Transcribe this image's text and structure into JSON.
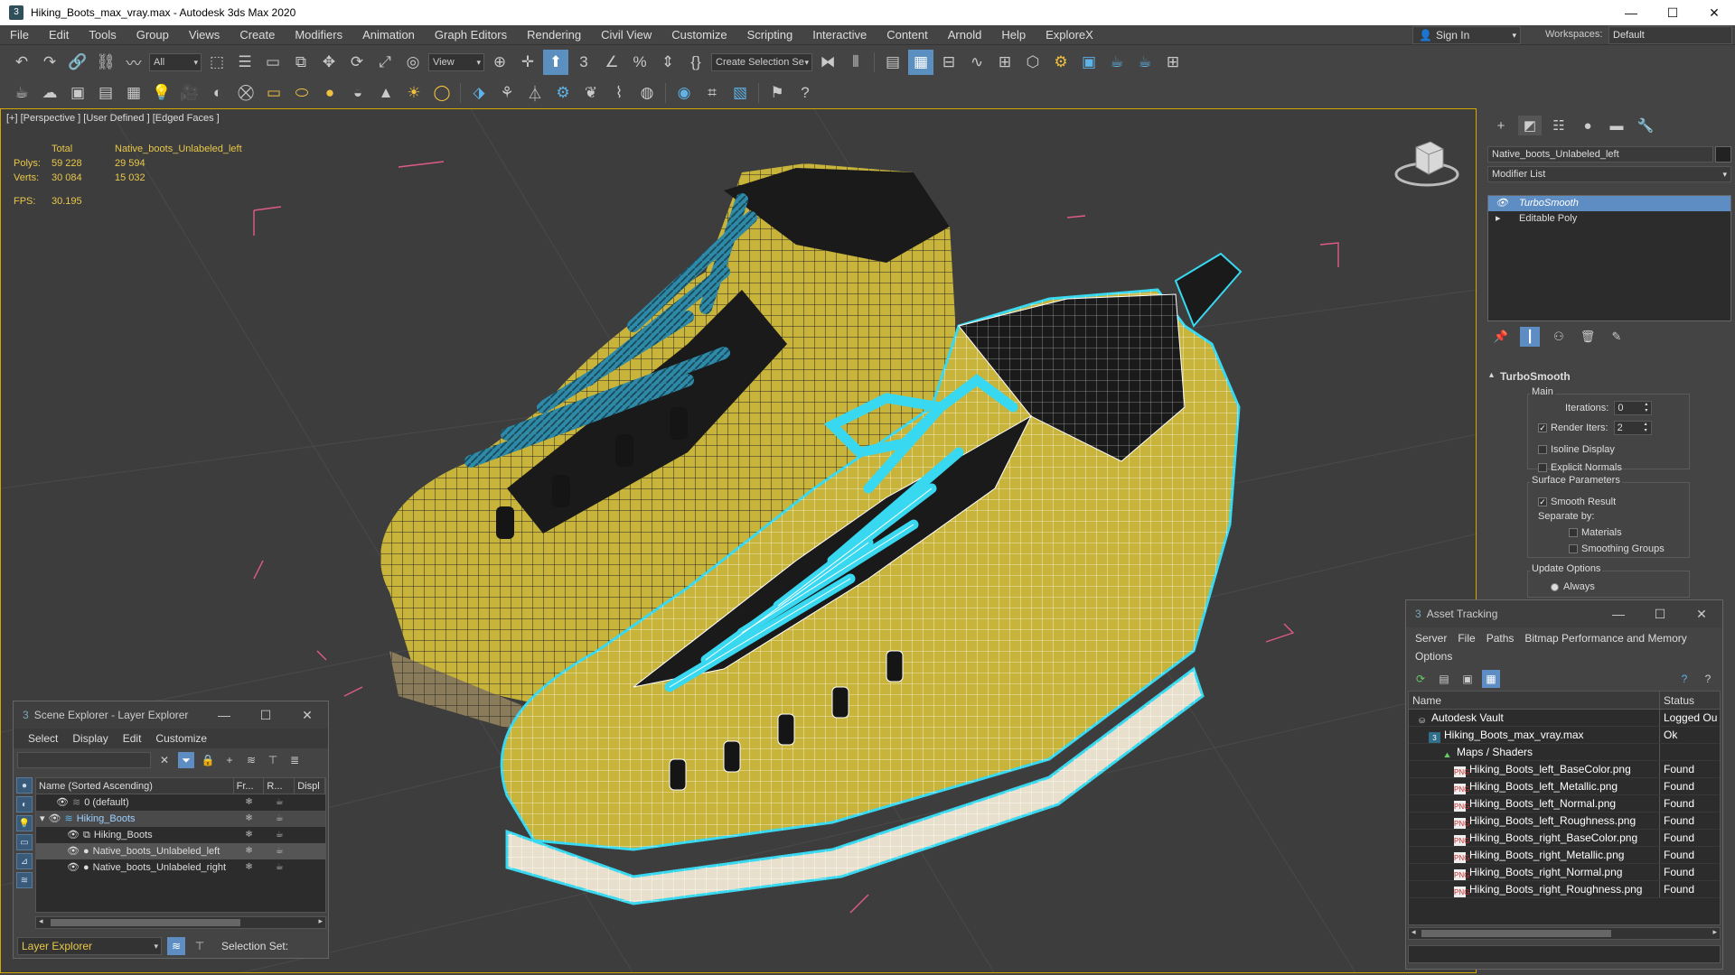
{
  "window": {
    "title": "Hiking_Boots_max_vray.max - Autodesk 3ds Max 2020",
    "controls": [
      "—",
      "☐",
      "✕"
    ]
  },
  "menubar": {
    "items": [
      "File",
      "Edit",
      "Tools",
      "Group",
      "Views",
      "Create",
      "Modifiers",
      "Animation",
      "Graph Editors",
      "Rendering",
      "Civil View",
      "Customize",
      "Scripting",
      "Interactive",
      "Content",
      "Arnold",
      "Help",
      "ExploreX"
    ],
    "sign_in": "Sign In",
    "workspaces_label": "Workspaces:",
    "workspace_value": "Default"
  },
  "toolbar": {
    "selection_filter": "All",
    "ref_coord": "View",
    "named_selection": "Create Selection Se"
  },
  "viewport": {
    "label": "[+] [Perspective ] [User Defined ] [Edged Faces ]",
    "stats": {
      "total_label": "Total",
      "object_label": "Native_boots_Unlabeled_left",
      "polys_label": "Polys:",
      "polys_total": "59 228",
      "polys_object": "29 594",
      "verts_label": "Verts:",
      "verts_total": "30 084",
      "verts_object": "15 032",
      "fps_label": "FPS:",
      "fps_value": "30.195"
    },
    "colors": {
      "frame": "#d4a800",
      "boot": "#c8b43a",
      "laces": "#2e8aa8",
      "selection": "#38d8f0",
      "bbox": "#e05a88"
    }
  },
  "command_panel": {
    "object_name": "Native_boots_Unlabeled_left",
    "modifier_list": "Modifier List",
    "stack": [
      "TurboSmooth",
      "Editable Poly"
    ],
    "rollout_title": "TurboSmooth",
    "main_group": "Main",
    "iterations_label": "Iterations:",
    "iterations_value": "0",
    "render_iters_label": "Render Iters:",
    "render_iters_value": "2",
    "isoline_display": "Isoline Display",
    "explicit_normals": "Explicit Normals",
    "surface_group": "Surface Parameters",
    "smooth_result": "Smooth Result",
    "separate_by": "Separate by:",
    "materials": "Materials",
    "smoothing_groups": "Smoothing Groups",
    "update_group": "Update Options",
    "always": "Always"
  },
  "asset_tracking": {
    "title": "Asset Tracking",
    "menu": [
      "Server",
      "File",
      "Paths",
      "Bitmap Performance and Memory",
      "Options"
    ],
    "col_name": "Name",
    "col_status": "Status",
    "rows": [
      {
        "name": "Autodesk Vault",
        "status": "Logged Ou",
        "indent": 0,
        "icon": "vault"
      },
      {
        "name": "Hiking_Boots_max_vray.max",
        "status": "Ok",
        "indent": 1,
        "icon": "max"
      },
      {
        "name": "Maps / Shaders",
        "status": "",
        "indent": 2,
        "icon": "maps"
      },
      {
        "name": "Hiking_Boots_left_BaseColor.png",
        "status": "Found",
        "indent": 3,
        "icon": "png"
      },
      {
        "name": "Hiking_Boots_left_Metallic.png",
        "status": "Found",
        "indent": 3,
        "icon": "png"
      },
      {
        "name": "Hiking_Boots_left_Normal.png",
        "status": "Found",
        "indent": 3,
        "icon": "png"
      },
      {
        "name": "Hiking_Boots_left_Roughness.png",
        "status": "Found",
        "indent": 3,
        "icon": "png"
      },
      {
        "name": "Hiking_Boots_right_BaseColor.png",
        "status": "Found",
        "indent": 3,
        "icon": "png"
      },
      {
        "name": "Hiking_Boots_right_Metallic.png",
        "status": "Found",
        "indent": 3,
        "icon": "png"
      },
      {
        "name": "Hiking_Boots_right_Normal.png",
        "status": "Found",
        "indent": 3,
        "icon": "png"
      },
      {
        "name": "Hiking_Boots_right_Roughness.png",
        "status": "Found",
        "indent": 3,
        "icon": "png"
      }
    ]
  },
  "scene_explorer": {
    "title": "Scene Explorer - Layer Explorer",
    "menu": [
      "Select",
      "Display",
      "Edit",
      "Customize"
    ],
    "columns": [
      "Name (Sorted Ascending)",
      "Fr...",
      "R...",
      "Displ"
    ],
    "rows": [
      {
        "name": "0 (default)",
        "indent": 0
      },
      {
        "name": "Hiking_Boots",
        "indent": 0
      },
      {
        "name": "Hiking_Boots",
        "indent": 1
      },
      {
        "name": "Native_boots_Unlabeled_left",
        "indent": 1
      },
      {
        "name": "Native_boots_Unlabeled_right",
        "indent": 1
      }
    ],
    "layer_explorer": "Layer Explorer",
    "selection_set": "Selection Set:"
  }
}
